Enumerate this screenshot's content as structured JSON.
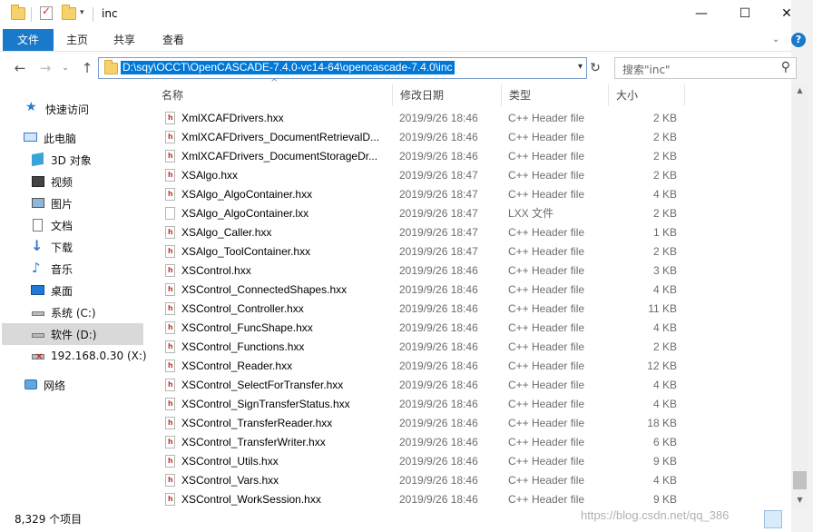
{
  "window": {
    "title": "inc",
    "minimize": "—",
    "maximize": "☐",
    "close": "✕"
  },
  "ribbon": {
    "tabs": [
      {
        "label": "文件",
        "active": true
      },
      {
        "label": "主页"
      },
      {
        "label": "共享"
      },
      {
        "label": "查看"
      }
    ],
    "help": "?"
  },
  "address": {
    "path": "D:\\sqy\\OCCT\\OpenCASCADE-7.4.0-vc14-64\\opencascade-7.4.0\\inc",
    "search_placeholder": "搜索\"inc\""
  },
  "nav": [
    {
      "label": "快速访问",
      "icon": "star-icon"
    },
    {
      "label": "此电脑",
      "icon": "computer-icon"
    },
    {
      "label": "3D 对象",
      "icon": "cube-icon"
    },
    {
      "label": "视频",
      "icon": "video-icon"
    },
    {
      "label": "图片",
      "icon": "picture-icon"
    },
    {
      "label": "文档",
      "icon": "document-icon"
    },
    {
      "label": "下载",
      "icon": "download-icon"
    },
    {
      "label": "音乐",
      "icon": "music-icon"
    },
    {
      "label": "桌面",
      "icon": "desktop-icon"
    },
    {
      "label": "系统 (C:)",
      "icon": "drive-icon"
    },
    {
      "label": "软件 (D:)",
      "icon": "drive-icon",
      "selected": true
    },
    {
      "label": "192.168.0.30 (X:)",
      "icon": "network-drive-icon"
    },
    {
      "label": "网络",
      "icon": "network-icon"
    }
  ],
  "columns": {
    "name": "名称",
    "date": "修改日期",
    "type": "类型",
    "size": "大小"
  },
  "files": [
    {
      "name": "XmlXCAFDrivers.hxx",
      "date": "2019/9/26 18:46",
      "type": "C++ Header file",
      "size": "2 KB",
      "icon": "h"
    },
    {
      "name": "XmlXCAFDrivers_DocumentRetrievalD...",
      "date": "2019/9/26 18:46",
      "type": "C++ Header file",
      "size": "2 KB",
      "icon": "h"
    },
    {
      "name": "XmlXCAFDrivers_DocumentStorageDr...",
      "date": "2019/9/26 18:46",
      "type": "C++ Header file",
      "size": "2 KB",
      "icon": "h"
    },
    {
      "name": "XSAlgo.hxx",
      "date": "2019/9/26 18:47",
      "type": "C++ Header file",
      "size": "2 KB",
      "icon": "h"
    },
    {
      "name": "XSAlgo_AlgoContainer.hxx",
      "date": "2019/9/26 18:47",
      "type": "C++ Header file",
      "size": "4 KB",
      "icon": "h"
    },
    {
      "name": "XSAlgo_AlgoContainer.lxx",
      "date": "2019/9/26 18:47",
      "type": "LXX 文件",
      "size": "2 KB",
      "icon": "blank"
    },
    {
      "name": "XSAlgo_Caller.hxx",
      "date": "2019/9/26 18:47",
      "type": "C++ Header file",
      "size": "1 KB",
      "icon": "h"
    },
    {
      "name": "XSAlgo_ToolContainer.hxx",
      "date": "2019/9/26 18:47",
      "type": "C++ Header file",
      "size": "2 KB",
      "icon": "h"
    },
    {
      "name": "XSControl.hxx",
      "date": "2019/9/26 18:46",
      "type": "C++ Header file",
      "size": "3 KB",
      "icon": "h"
    },
    {
      "name": "XSControl_ConnectedShapes.hxx",
      "date": "2019/9/26 18:46",
      "type": "C++ Header file",
      "size": "4 KB",
      "icon": "h"
    },
    {
      "name": "XSControl_Controller.hxx",
      "date": "2019/9/26 18:46",
      "type": "C++ Header file",
      "size": "11 KB",
      "icon": "h"
    },
    {
      "name": "XSControl_FuncShape.hxx",
      "date": "2019/9/26 18:46",
      "type": "C++ Header file",
      "size": "4 KB",
      "icon": "h"
    },
    {
      "name": "XSControl_Functions.hxx",
      "date": "2019/9/26 18:46",
      "type": "C++ Header file",
      "size": "2 KB",
      "icon": "h"
    },
    {
      "name": "XSControl_Reader.hxx",
      "date": "2019/9/26 18:46",
      "type": "C++ Header file",
      "size": "12 KB",
      "icon": "h"
    },
    {
      "name": "XSControl_SelectForTransfer.hxx",
      "date": "2019/9/26 18:46",
      "type": "C++ Header file",
      "size": "4 KB",
      "icon": "h"
    },
    {
      "name": "XSControl_SignTransferStatus.hxx",
      "date": "2019/9/26 18:46",
      "type": "C++ Header file",
      "size": "4 KB",
      "icon": "h"
    },
    {
      "name": "XSControl_TransferReader.hxx",
      "date": "2019/9/26 18:46",
      "type": "C++ Header file",
      "size": "18 KB",
      "icon": "h"
    },
    {
      "name": "XSControl_TransferWriter.hxx",
      "date": "2019/9/26 18:46",
      "type": "C++ Header file",
      "size": "6 KB",
      "icon": "h"
    },
    {
      "name": "XSControl_Utils.hxx",
      "date": "2019/9/26 18:46",
      "type": "C++ Header file",
      "size": "9 KB",
      "icon": "h"
    },
    {
      "name": "XSControl_Vars.hxx",
      "date": "2019/9/26 18:46",
      "type": "C++ Header file",
      "size": "4 KB",
      "icon": "h"
    },
    {
      "name": "XSControl_WorkSession.hxx",
      "date": "2019/9/26 18:46",
      "type": "C++ Header file",
      "size": "9 KB",
      "icon": "h"
    }
  ],
  "status": {
    "count": "8,329 个项目"
  },
  "watermark": "https://blog.csdn.net/qq_386"
}
